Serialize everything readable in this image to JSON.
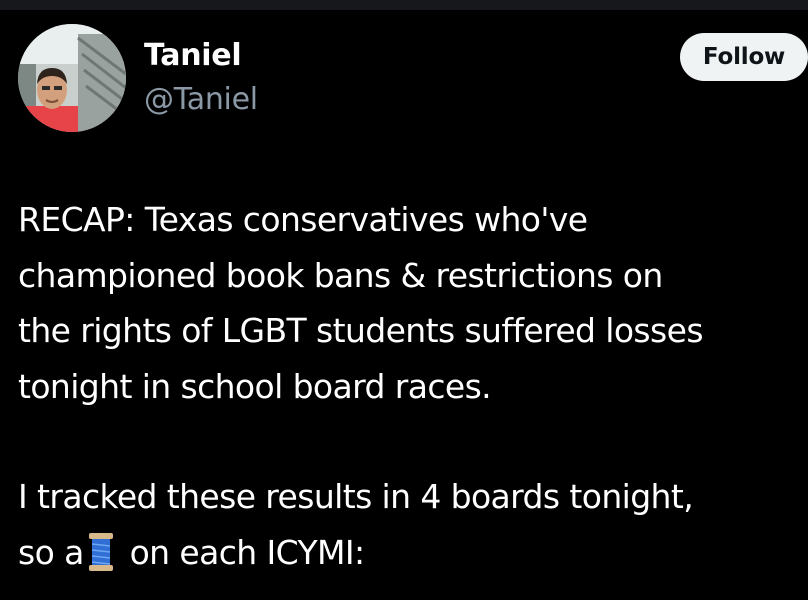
{
  "profile": {
    "display_name": "Taniel",
    "handle": "@Taniel",
    "follow_label": "Follow"
  },
  "tweet": {
    "lines": [
      "RECAP: Texas conservatives who've",
      "championed book bans & restrictions on",
      "the rights of LGBT students suffered losses",
      "tonight in school board races."
    ],
    "line2_1": "I tracked these results in 4 boards tonight,",
    "line2_2_before": "so a",
    "line2_2_emoji": "spool-of-thread-icon",
    "line2_2_after": "on each ICYMI:"
  },
  "colors": {
    "background": "#000000",
    "text": "#ffffff",
    "secondary_text": "#8b98a5",
    "button_bg": "#eff3f4",
    "button_text": "#0f1419"
  }
}
